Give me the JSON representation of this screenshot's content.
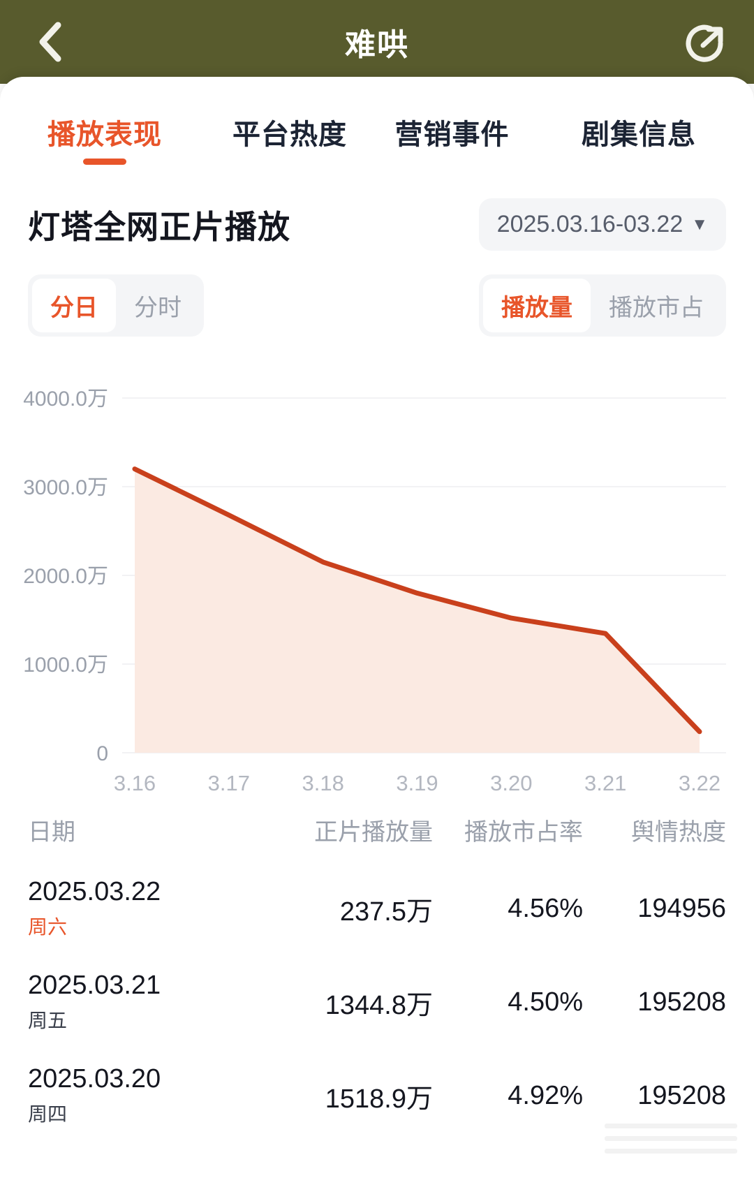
{
  "header": {
    "title": "难哄",
    "back_icon": "chevron-left-icon",
    "share_icon": "share-circle-icon",
    "bg_color": "#585B2D"
  },
  "tabs": [
    {
      "label": "播放表现",
      "active": true
    },
    {
      "label": "平台热度",
      "active": false
    },
    {
      "label": "营销事件",
      "active": false
    },
    {
      "label": "剧集信息",
      "active": false
    }
  ],
  "panel": {
    "title": "灯塔全网正片播放",
    "date_range": "2025.03.16-03.22",
    "date_caret": "▼",
    "granularity": [
      {
        "label": "分日",
        "active": true
      },
      {
        "label": "分时",
        "active": false
      }
    ],
    "metric": [
      {
        "label": "播放量",
        "active": true
      },
      {
        "label": "播放市占",
        "active": false
      }
    ],
    "accent_color": "#E8552A"
  },
  "chart_data": {
    "type": "area",
    "title": "灯塔全网正片播放",
    "xlabel": "",
    "ylabel": "",
    "categories": [
      "3.16",
      "3.17",
      "3.18",
      "3.19",
      "3.20",
      "3.21",
      "3.22"
    ],
    "values": [
      3200.0,
      2680.0,
      2150.0,
      1800.0,
      1518.9,
      1344.8,
      237.5
    ],
    "unit": "万",
    "ytick_labels": [
      "4000.0万",
      "3000.0万",
      "2000.0万",
      "1000.0万",
      "0"
    ],
    "ytick_values": [
      4000,
      3000,
      2000,
      1000,
      0
    ],
    "ylim": [
      0,
      4000
    ],
    "grid": true,
    "legend": "none",
    "line_color": "#C9401C",
    "fill_color": "#FBEAE2"
  },
  "table": {
    "columns": [
      "日期",
      "正片播放量",
      "播放市占率",
      "舆情热度"
    ],
    "rows": [
      {
        "date": "2025.03.22",
        "weekday": "周六",
        "weekend": true,
        "plays": "237.5万",
        "share": "4.56%",
        "heat": "194956"
      },
      {
        "date": "2025.03.21",
        "weekday": "周五",
        "weekend": false,
        "plays": "1344.8万",
        "share": "4.50%",
        "heat": "195208"
      },
      {
        "date": "2025.03.20",
        "weekday": "周四",
        "weekend": false,
        "plays": "1518.9万",
        "share": "4.92%",
        "heat": "195208"
      }
    ]
  }
}
